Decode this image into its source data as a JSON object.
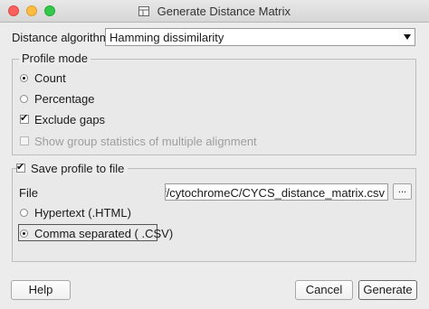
{
  "window": {
    "title": "Generate Distance Matrix"
  },
  "algorithm": {
    "label": "Distance algorithm",
    "value": "Hamming dissimilarity"
  },
  "profile_mode": {
    "title": "Profile mode",
    "count": "Count",
    "percentage": "Percentage",
    "exclude_gaps": "Exclude gaps",
    "group_stats": "Show group statistics of multiple alignment"
  },
  "save": {
    "label": "Save profile to file",
    "file_label": "File",
    "file_value": "stuff/cytochromeC/CYCS_distance_matrix.csv",
    "browse_label": "...",
    "hypertext": "Hypertext  (.HTML)",
    "csv": "Comma separated ( .CSV)"
  },
  "buttons": {
    "help": "Help",
    "cancel": "Cancel",
    "generate": "Generate"
  }
}
